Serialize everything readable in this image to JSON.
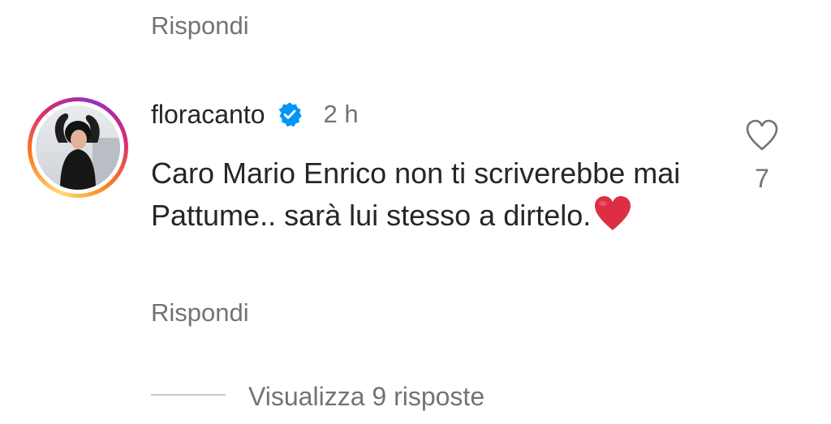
{
  "previous_comment": {
    "reply_label": "Rispondi"
  },
  "comment": {
    "username": "floracanto",
    "verified": true,
    "verified_badge_color": "#0095f6",
    "time_ago": "2 h",
    "text": "Caro Mario Enrico non ti scriverebbe mai Pattume.. sarà lui stesso a dirtelo.",
    "emoji": "red-heart-emoji",
    "reply_label": "Rispondi",
    "likes": "7",
    "like_icon": "heart-outline-icon"
  },
  "replies": {
    "view_label": "Visualizza 9 risposte"
  },
  "colors": {
    "text_primary": "#262626",
    "text_secondary": "#737373",
    "heart_red": "#dd2e44"
  }
}
